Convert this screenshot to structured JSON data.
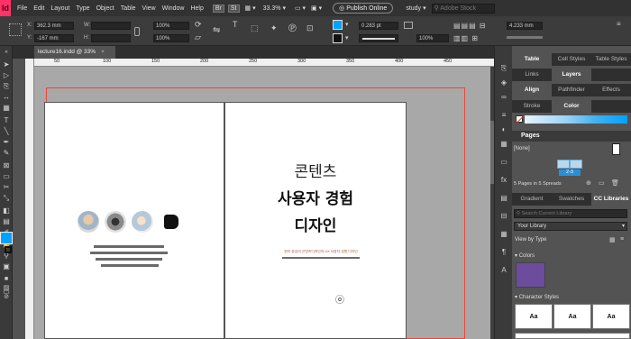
{
  "app": {
    "logo": "Id"
  },
  "menu": [
    "File",
    "Edit",
    "Layout",
    "Type",
    "Object",
    "Table",
    "View",
    "Window",
    "Help"
  ],
  "topbar": {
    "br": "Br",
    "st": "St",
    "zoom": "33.3%",
    "publish": "Publish Online",
    "workspace": "study",
    "search_placeholder": "Adobe Stock"
  },
  "control": {
    "x_label": "X:",
    "x_value": "362.3 mm",
    "y_label": "Y:",
    "y_value": "-167 mm",
    "w_label": "W:",
    "h_label": "H:",
    "stroke_weight": "0.283 pt",
    "opacity": "100%",
    "size_value": "4.233 mm",
    "pct_left": "100%",
    "pct_right": "100%"
  },
  "document": {
    "tab_title": "lecture16.indd @ 33%",
    "ruler_marks": [
      "50",
      "100",
      "150",
      "200",
      "250",
      "300",
      "350",
      "400",
      "450"
    ]
  },
  "page_right": {
    "line1": "콘텐츠",
    "line2": "사용자 경험",
    "line3": "디자인",
    "subtitle": "원리 중심의 콘텐츠디자인과 UX 사용자 경험 디자인"
  },
  "panels": {
    "row1": [
      "Table",
      "Cell Styles",
      "Table Styles"
    ],
    "row2": [
      "Links",
      "Layers"
    ],
    "row3": [
      "Align",
      "Pathfinder",
      "Effects"
    ],
    "row4": [
      "Stroke",
      "Color"
    ],
    "pages_title": "Pages",
    "none_label": "[None]",
    "spread_label": "2-3",
    "pages_status": "5 Pages in 5 Spreads",
    "row5": [
      "Gradient",
      "Swatches",
      "CC Libraries"
    ],
    "library_search_placeholder": "Search Current Library",
    "library": "Your Library",
    "view_by": "View by Type",
    "colors_title": "Colors",
    "char_styles_title": "Character Styles",
    "aa": "Aa"
  },
  "colors": {
    "accent": "#00a2ff",
    "library_swatch": "#6d4c9e",
    "bleed_line": "#e8473c"
  }
}
